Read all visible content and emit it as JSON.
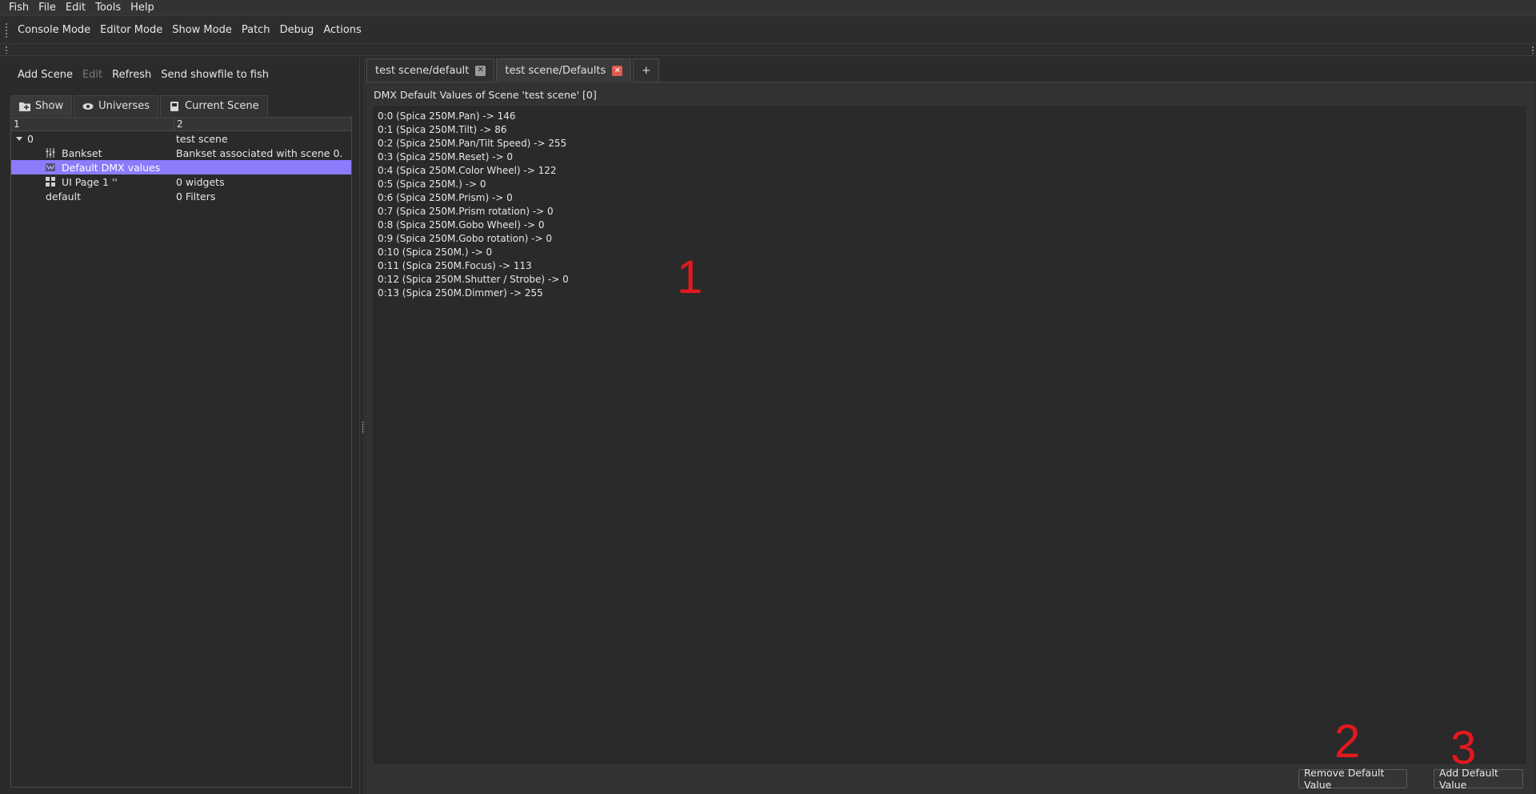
{
  "menu": [
    "Fish",
    "File",
    "Edit",
    "Tools",
    "Help"
  ],
  "modes": [
    "Console Mode",
    "Editor Mode",
    "Show Mode",
    "Patch",
    "Debug",
    "Actions"
  ],
  "scene_toolbar": {
    "add_scene": "Add Scene",
    "edit": "Edit",
    "refresh": "Refresh",
    "send_showfile": "Send showfile to fish"
  },
  "left_tabs": [
    {
      "label": "Show",
      "icon": "folder-icon"
    },
    {
      "label": "Universes",
      "icon": "eye-icon"
    },
    {
      "label": "Current Scene",
      "icon": "scene-icon"
    }
  ],
  "tree": {
    "headers": [
      "1",
      "2"
    ],
    "rows": [
      {
        "col1": "0",
        "col2": "test scene",
        "expanded": true
      },
      {
        "col1": "Bankset",
        "col2": "Bankset associated with scene 0.",
        "icon": "bankset-icon"
      },
      {
        "col1": "Default DMX values",
        "col2": "",
        "icon": "dmx-values-icon",
        "selected": true
      },
      {
        "col1": "UI Page 1 ''",
        "col2": "0 widgets",
        "icon": "ui-page-icon"
      },
      {
        "col1": "default",
        "col2": "0 Filters"
      }
    ]
  },
  "doc_tabs": [
    {
      "label": "test scene/default",
      "active": false
    },
    {
      "label": "test scene/Defaults",
      "active": true
    },
    {
      "label": "+"
    }
  ],
  "content": {
    "title": "DMX Default Values of Scene 'test scene' [0]",
    "values": [
      "0:0 (Spica 250M.Pan) -> 146",
      "0:1 (Spica 250M.Tilt) -> 86",
      "0:2 (Spica 250M.Pan/Tilt Speed) -> 255",
      "0:3 (Spica 250M.Reset) -> 0",
      "0:4 (Spica 250M.Color Wheel) -> 122",
      "0:5 (Spica 250M.) -> 0",
      "0:6 (Spica 250M.Prism) -> 0",
      "0:7 (Spica 250M.Prism rotation) -> 0",
      "0:8 (Spica 250M.Gobo Wheel) -> 0",
      "0:9 (Spica 250M.Gobo rotation) -> 0",
      "0:10 (Spica 250M.) -> 0",
      "0:11 (Spica 250M.Focus) -> 113",
      "0:12 (Spica 250M.Shutter / Strobe) -> 0",
      "0:13 (Spica 250M.Dimmer) -> 255"
    ],
    "remove_button": "Remove Default Value",
    "add_button": "Add Default Value"
  },
  "callouts": [
    "1",
    "2",
    "3"
  ],
  "colors": {
    "selection": "#8a7cfb",
    "callout": "#e3191e",
    "close_active": "#e05a4f"
  }
}
